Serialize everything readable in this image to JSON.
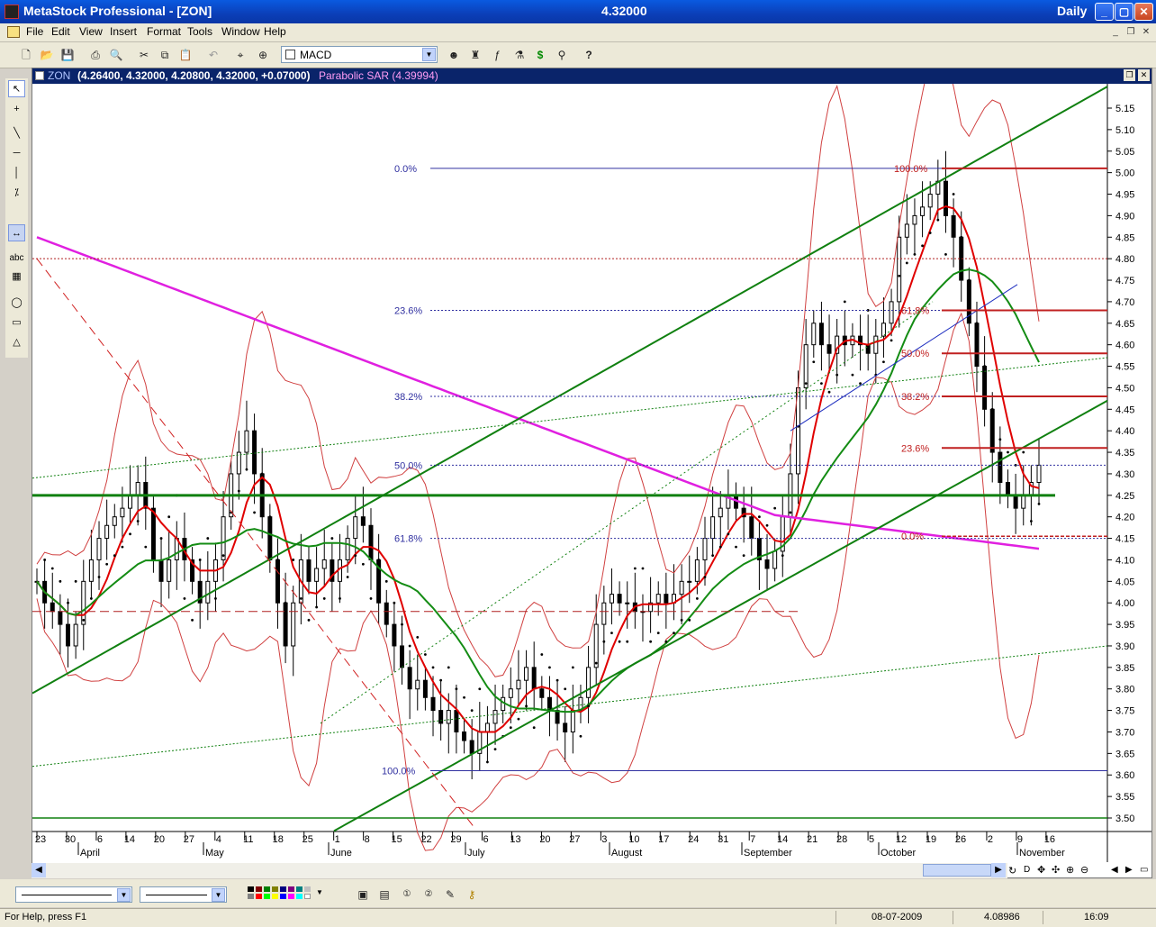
{
  "app": {
    "title": "MetaStock Professional - [ZON]",
    "last_price": "4.32000",
    "period": "Daily"
  },
  "menu": [
    "File",
    "Edit",
    "View",
    "Insert",
    "Format",
    "Tools",
    "Window",
    "Help"
  ],
  "toolbar": {
    "indicator_select": "MACD"
  },
  "chart": {
    "symbol": "ZON",
    "ohlc": "(4.26400, 4.32000, 4.20800, 4.32000, +0.07000)",
    "indicator_label": "Parabolic SAR (4.39994)",
    "fib_left_labels": [
      "0.0%",
      "23.6%",
      "38.2%",
      "50.0%",
      "61.8%",
      "100.0%"
    ],
    "fib_right_labels": [
      "100.0%",
      "61.8%",
      "50.0%",
      "38.2%",
      "23.6%",
      "0.0%"
    ],
    "colors": {
      "candle": "#000000",
      "ma_red": "#e00000",
      "ma_green": "#148c14",
      "ma_magenta": "#e020e0",
      "trendline": "#108010",
      "bollinger": "#d04040",
      "fib_left": "#3030a0",
      "fib_right": "#c02020",
      "sar": "#000000"
    }
  },
  "chart_data": {
    "type": "line",
    "title": "",
    "ylim": [
      3.48,
      5.2
    ],
    "y_ticks": [
      "5.15",
      "5.10",
      "5.05",
      "5.00",
      "4.95",
      "4.90",
      "4.85",
      "4.80",
      "4.75",
      "4.70",
      "4.65",
      "4.60",
      "4.55",
      "4.50",
      "4.45",
      "4.40",
      "4.35",
      "4.30",
      "4.25",
      "4.20",
      "4.15",
      "4.10",
      "4.05",
      "4.00",
      "3.95",
      "3.90",
      "3.85",
      "3.80",
      "3.75",
      "3.70",
      "3.65",
      "3.60",
      "3.55",
      "3.50"
    ],
    "x_day_ticks": [
      "23",
      "30",
      "6",
      "14",
      "20",
      "27",
      "4",
      "11",
      "18",
      "25",
      "1",
      "8",
      "15",
      "22",
      "29",
      "6",
      "13",
      "20",
      "27",
      "3",
      "10",
      "17",
      "24",
      "31",
      "7",
      "14",
      "21",
      "28",
      "5",
      "12",
      "19",
      "26",
      "2",
      "9",
      "16"
    ],
    "x_month_ticks": [
      "April",
      "May",
      "June",
      "July",
      "August",
      "September",
      "October",
      "November"
    ],
    "series": [
      {
        "values": [
          4.05,
          4.0,
          3.98,
          3.95,
          3.9,
          3.95,
          4.05,
          4.1,
          4.15,
          4.18,
          4.2,
          4.22,
          4.25,
          4.28,
          4.22,
          4.1,
          4.05,
          4.1,
          4.15,
          4.1,
          4.05,
          4.0,
          4.05,
          4.1,
          4.2,
          4.3,
          4.35,
          4.4,
          4.3,
          4.2,
          4.1,
          4.0,
          3.9,
          4.0,
          4.1,
          4.05,
          4.08,
          4.1,
          4.05,
          4.1,
          4.15,
          4.2,
          4.18,
          4.1,
          4.0,
          3.95,
          3.9,
          3.85,
          3.8,
          3.82,
          3.78,
          3.75,
          3.72,
          3.75,
          3.7,
          3.68,
          3.65,
          3.7,
          3.72,
          3.75,
          3.78,
          3.8,
          3.82,
          3.85,
          3.8,
          3.78,
          3.75,
          3.72,
          3.7,
          3.75,
          3.78,
          3.85,
          3.95,
          4.0,
          4.02,
          4.0,
          4.0,
          3.98,
          3.98,
          4.0,
          4.02,
          4.0,
          4.02,
          4.05,
          4.05,
          4.1,
          4.15,
          4.2,
          4.22,
          4.25,
          4.22,
          4.2,
          4.15,
          4.1,
          4.08,
          4.12,
          4.2,
          4.3,
          4.5,
          4.6,
          4.65,
          4.6,
          4.58,
          4.62,
          4.6,
          4.62,
          4.6,
          4.58,
          4.62,
          4.65,
          4.7,
          4.85,
          4.88,
          4.9,
          4.92,
          4.95,
          4.98,
          4.9,
          4.85,
          4.75,
          4.65,
          4.55,
          4.45,
          4.35,
          4.28,
          4.25,
          4.22,
          4.25,
          4.28,
          4.32
        ]
      }
    ]
  },
  "bottom": {
    "status_help": "For Help, press F1",
    "date": "08-07-2009",
    "value": "4.08986",
    "time": "16:09"
  }
}
